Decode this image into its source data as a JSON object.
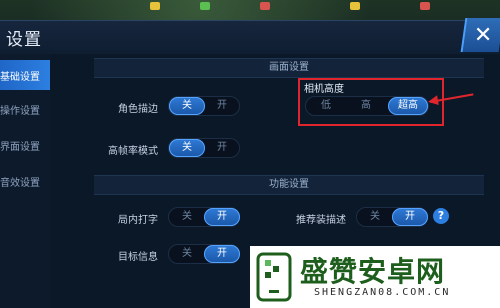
{
  "window": {
    "title": "设置",
    "close_label": "✕"
  },
  "sidebar": {
    "items": [
      {
        "label": "基础设置",
        "active": true
      },
      {
        "label": "操作设置",
        "active": false
      },
      {
        "label": "界面设置",
        "active": false
      },
      {
        "label": "音效设置",
        "active": false
      }
    ]
  },
  "sections": {
    "graphics": "画面设置",
    "function": "功能设置"
  },
  "settings": {
    "hero_outline": {
      "label": "角色描边",
      "off": "关",
      "on": "开",
      "value": "关"
    },
    "high_fps": {
      "label": "高帧率模式",
      "off": "关",
      "on": "开",
      "value": "关"
    },
    "camera_height": {
      "label": "相机高度",
      "options": [
        "低",
        "高",
        "超高"
      ],
      "value": "超高"
    },
    "in_game_typing": {
      "label": "局内打字",
      "off": "关",
      "on": "开",
      "value": "开"
    },
    "recommend_gear": {
      "label": "推荐装描述",
      "off": "关",
      "on": "开",
      "value": "开",
      "help": "?"
    },
    "target_info": {
      "label": "目标信息",
      "off": "关",
      "on": "开",
      "value": "开"
    }
  },
  "watermark": {
    "brand": "盛赞安卓网",
    "site": "SHENGZAN08.COM.CN"
  },
  "colors": {
    "accent": "#2c7fe0",
    "highlight_box": "#e0262c"
  }
}
